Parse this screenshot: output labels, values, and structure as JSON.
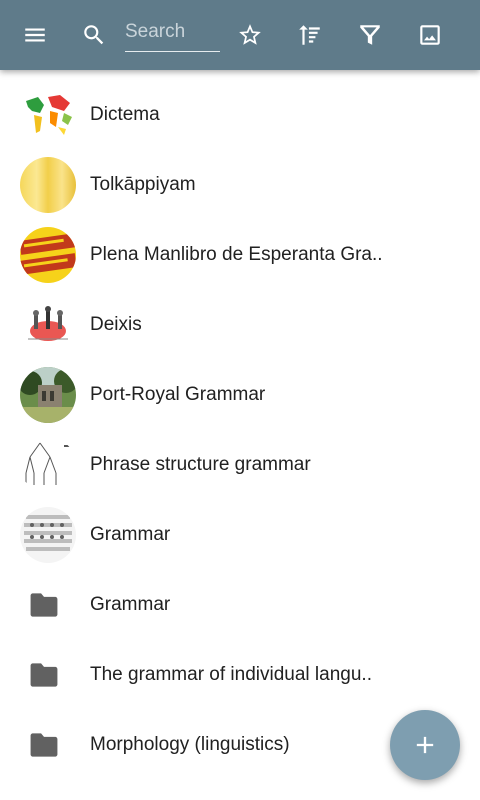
{
  "toolbar": {
    "menu_icon": "menu-icon",
    "search_icon": "search-icon",
    "search_placeholder": "Search",
    "search_value": "",
    "star_icon": "star-outline-icon",
    "sort_icon": "sort-icon",
    "filter_icon": "filter-icon",
    "image_icon": "image-icon",
    "background_color": "#5f7b8a"
  },
  "items": [
    {
      "type": "article",
      "label": "Dictema",
      "icon": "world-map-thumbnail"
    },
    {
      "type": "article",
      "label": "Tolkāppiyam",
      "icon": "yellow-texture-thumbnail"
    },
    {
      "type": "article",
      "label": "Plena Manlibro de Esperanta Gra..",
      "icon": "book-cover-thumbnail"
    },
    {
      "type": "article",
      "label": "Deixis",
      "icon": "deixis-diagram-thumbnail"
    },
    {
      "type": "article",
      "label": "Port-Royal Grammar",
      "icon": "abbey-photo-thumbnail"
    },
    {
      "type": "article",
      "label": "Phrase structure grammar",
      "icon": "tree-diagram-thumbnail"
    },
    {
      "type": "article",
      "label": "Grammar",
      "icon": "chart-thumbnail"
    },
    {
      "type": "folder",
      "label": "Grammar",
      "icon": "folder-icon"
    },
    {
      "type": "folder",
      "label": "The grammar of individual langu..",
      "icon": "folder-icon"
    },
    {
      "type": "folder",
      "label": "Morphology (linguistics)",
      "icon": "folder-icon"
    }
  ],
  "fab": {
    "icon": "plus-icon",
    "color": "#7e9eb0"
  }
}
